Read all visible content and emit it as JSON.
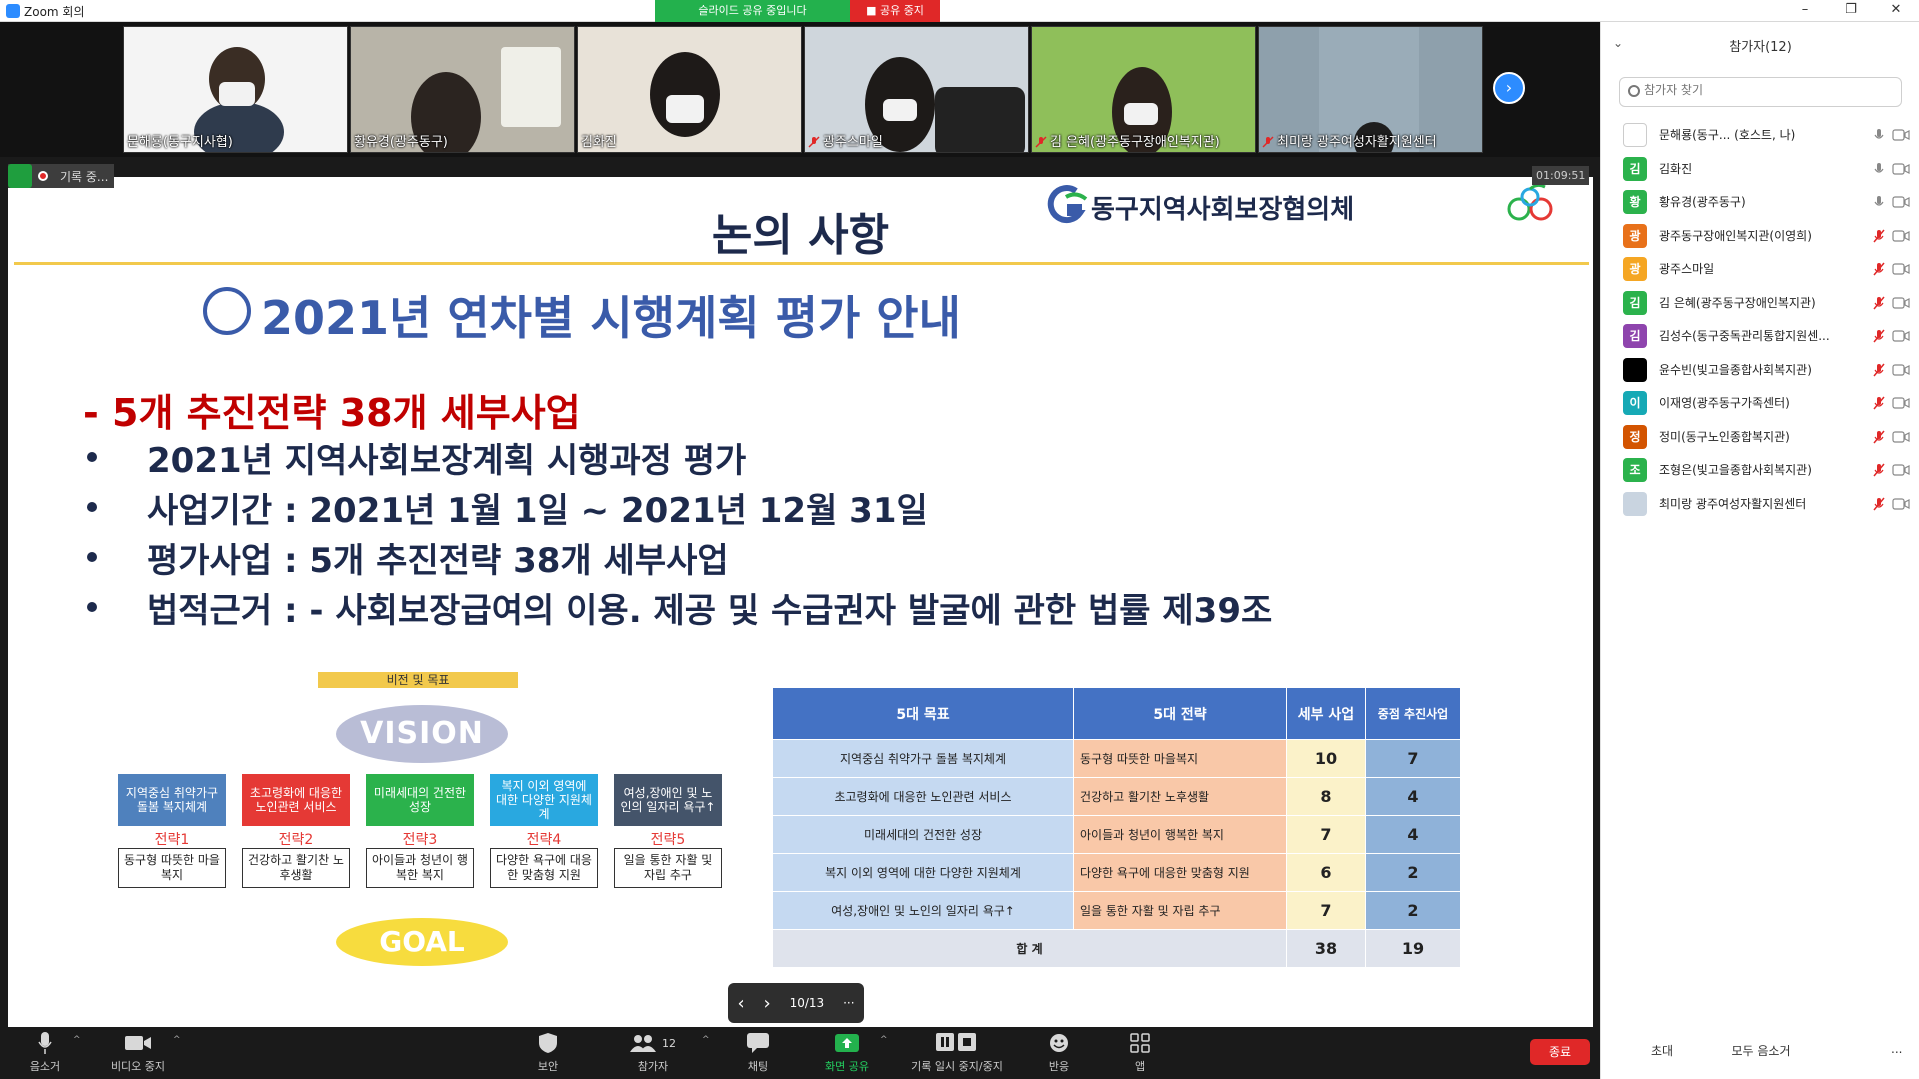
{
  "window": {
    "title": "Zoom 회의",
    "minimize": "–",
    "maximize": "❐",
    "close": "✕"
  },
  "share_bar": {
    "status": "슬라이드 공유 중입니다",
    "stop": "■ 공유 중지"
  },
  "thumbnails": [
    {
      "name": "문해룡(동구지사협)",
      "muted": false,
      "bg": "#f4f4f4"
    },
    {
      "name": "황유경(광주동구)",
      "muted": false,
      "bg": "#b8b4a8"
    },
    {
      "name": "김화진",
      "muted": false,
      "bg": "#e8e2d8"
    },
    {
      "name": "광주스마일",
      "muted": true,
      "bg": "#cfd6dc"
    },
    {
      "name": "김 은혜(광주동구장애인복지관)",
      "muted": true,
      "bg": "#8fbf5a"
    },
    {
      "name": "최미랑 광주여성자활지원센터",
      "muted": true,
      "bg": "#8ea0ac"
    }
  ],
  "recording": {
    "label": "기록 중...",
    "timer": "01:09:51"
  },
  "slide": {
    "title": "논의 사항",
    "org": "동구지역사회보장협의체",
    "subtitle": "2021년 연차별 시행계획 평가 안내",
    "key_strategy": "- 5개 추진전략 38개 세부사업",
    "bullets": [
      "2021년 지역사회보장계획 시행과정 평가",
      "사업기간 : 2021년 1월 1일 ~ 2021년 12월 31일",
      "평가사업 : 5개 추진전략 38개 세부사업",
      "법적근거 : - 사회보장급여의 이용. 제공 및 수급권자 발굴에 관한 법률 제39조"
    ],
    "vision": {
      "tag": "비전 및 목표",
      "vision_label": "VISION",
      "goal_label": "GOAL",
      "goals": [
        {
          "text": "지역중심 취약가구 돌봄 복지체계",
          "color": "#4f81bd"
        },
        {
          "text": "초고령화에 대응한 노인관련 서비스",
          "color": "#e53935"
        },
        {
          "text": "미래세대의 건전한 성장",
          "color": "#2bb24c"
        },
        {
          "text": "복지 이외 영역에 대한 다양한 지원체계",
          "color": "#29a8e0"
        },
        {
          "text": "여성,장애인 및 노인의 일자리 욕구↑",
          "color": "#44546a"
        }
      ],
      "strategies": [
        {
          "label": "전략1",
          "text": "동구형 따뜻한 마을복지"
        },
        {
          "label": "전략2",
          "text": "건강하고 활기찬 노후생활"
        },
        {
          "label": "전략3",
          "text": "아이들과 청년이 행복한 복지"
        },
        {
          "label": "전략4",
          "text": "다양한 욕구에 대응한 맞춤형 지원"
        },
        {
          "label": "전략5",
          "text": "일을 통한 자활 및 자립 추구"
        }
      ]
    },
    "table": {
      "headers": [
        "5대 목표",
        "5대 전략",
        "세부 사업",
        "중점 추진사업"
      ],
      "rows": [
        {
          "goal": "지역중심 취약가구 돌봄 복지체계",
          "strategy": "동구형 따뜻한 마을복지",
          "sub": "10",
          "key": "7"
        },
        {
          "goal": "초고령화에 대응한 노인관련 서비스",
          "strategy": "건강하고 활기찬 노후생활",
          "sub": "8",
          "key": "4"
        },
        {
          "goal": "미래세대의 건전한 성장",
          "strategy": "아이들과 청년이 행복한 복지",
          "sub": "7",
          "key": "4"
        },
        {
          "goal": "복지 이외 영역에 대한 다양한 지원체계",
          "strategy": "다양한 욕구에 대응한 맞춤형 지원",
          "sub": "6",
          "key": "2"
        },
        {
          "goal": "여성,장애인 및 노인의 일자리 욕구↑",
          "strategy": "일을 통한 자활 및 자립 추구",
          "sub": "7",
          "key": "2"
        }
      ],
      "total": {
        "label": "합 계",
        "sub": "38",
        "key": "19"
      }
    }
  },
  "pager": {
    "prev": "‹",
    "next": "›",
    "page": "10/13",
    "more": "···"
  },
  "toolbar": {
    "mute": "음소거",
    "video": "비디오 중지",
    "security": "보안",
    "participants": "참가자",
    "participants_count": "12",
    "chat": "채팅",
    "share": "화면 공유",
    "record": "기록 일시 중지/중지",
    "reactions": "반응",
    "apps": "앱",
    "end": "종료"
  },
  "panel": {
    "title": "참가자(12)",
    "search_placeholder": "참가자 찾기",
    "participants": [
      {
        "name": "문해룡(동구... (호스트, 나)",
        "initial": "",
        "color": "#ffffff",
        "mic": "on",
        "cam": "on"
      },
      {
        "name": "김화진",
        "initial": "김",
        "color": "#2bb24c",
        "mic": "on",
        "cam": "on"
      },
      {
        "name": "황유경(광주동구)",
        "initial": "황",
        "color": "#2bb24c",
        "mic": "on",
        "cam": "on"
      },
      {
        "name": "광주동구장애인복지관(이영희)",
        "initial": "광",
        "color": "#e8711a",
        "mic": "muted",
        "cam": "on"
      },
      {
        "name": "광주스마일",
        "initial": "광",
        "color": "#f5a623",
        "mic": "muted",
        "cam": "on"
      },
      {
        "name": "김 은혜(광주동구장애인복지관)",
        "initial": "김",
        "color": "#2bb24c",
        "mic": "muted",
        "cam": "on"
      },
      {
        "name": "김성수(동구중독관리통합지원센...",
        "initial": "김",
        "color": "#8e44ad",
        "mic": "muted",
        "cam": "on"
      },
      {
        "name": "윤수빈(빛고을종합사회복지관)",
        "initial": "",
        "color": "#000000",
        "mic": "muted",
        "cam": "on"
      },
      {
        "name": "이재영(광주동구가족센터)",
        "initial": "이",
        "color": "#16a9b5",
        "mic": "muted",
        "cam": "on"
      },
      {
        "name": "정미(동구노인종합복지관)",
        "initial": "정",
        "color": "#d35400",
        "mic": "muted",
        "cam": "on"
      },
      {
        "name": "조형은(빛고을종합사회복지관)",
        "initial": "조",
        "color": "#2bb24c",
        "mic": "muted",
        "cam": "on"
      },
      {
        "name": "최미랑 광주여성자활지원센터",
        "initial": "",
        "color": "#c9d4e0",
        "mic": "muted",
        "cam": "on"
      }
    ],
    "invite": "초대",
    "mute_all": "모두 음소거",
    "more": "..."
  }
}
